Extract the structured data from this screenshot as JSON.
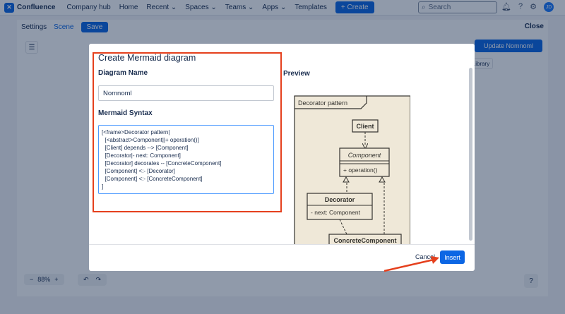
{
  "topnav": {
    "logo_letter": "✕",
    "brand": "Confluence",
    "items": [
      "Company hub",
      "Home",
      "Recent ⌄",
      "Spaces ⌄",
      "Teams ⌄",
      "Apps ⌄",
      "Templates"
    ],
    "create_label": "+ Create",
    "search_placeholder": "Search",
    "avatar_initials": "JD"
  },
  "editor": {
    "tabs": [
      "Settings",
      "Scene"
    ],
    "save_label": "Save",
    "close_label": "Close",
    "update_label": "Update Nomnoml",
    "library_label": "Library",
    "zoom_value": "88%",
    "zoom_minus": "−",
    "zoom_plus": "+",
    "undo": "↶",
    "redo": "↷",
    "help": "?"
  },
  "modal": {
    "title": "Create Mermaid diagram",
    "name_label": "Diagram Name",
    "name_value": "Nomnoml",
    "syntax_label": "Mermaid Syntax",
    "syntax_lines": [
      "[<frame>Decorator pattern|",
      "  [<abstract>Component||+ operation()]",
      "  [Client] depends --> [Component]",
      "  [Decorator|- next: Component]",
      "  [Decorator] decorates -- [ConcreteComponent]",
      "  [Component] <:- [Decorator]",
      "  [Component] <:- [ConcreteComponent]",
      "]"
    ],
    "preview_label": "Preview",
    "cancel_label": "Cancel",
    "insert_label": "Insert"
  },
  "preview": {
    "frame_title": "Decorator pattern",
    "client": "Client",
    "component": "Component",
    "operation": "+ operation()",
    "decorator": "Decorator",
    "next": "- next: Component",
    "concrete": "ConcreteComponent"
  },
  "colors": {
    "accent": "#0c66e4",
    "highlight": "#e5401d",
    "diagram_bg": "#efe8d8",
    "diagram_stroke": "#33322e"
  }
}
